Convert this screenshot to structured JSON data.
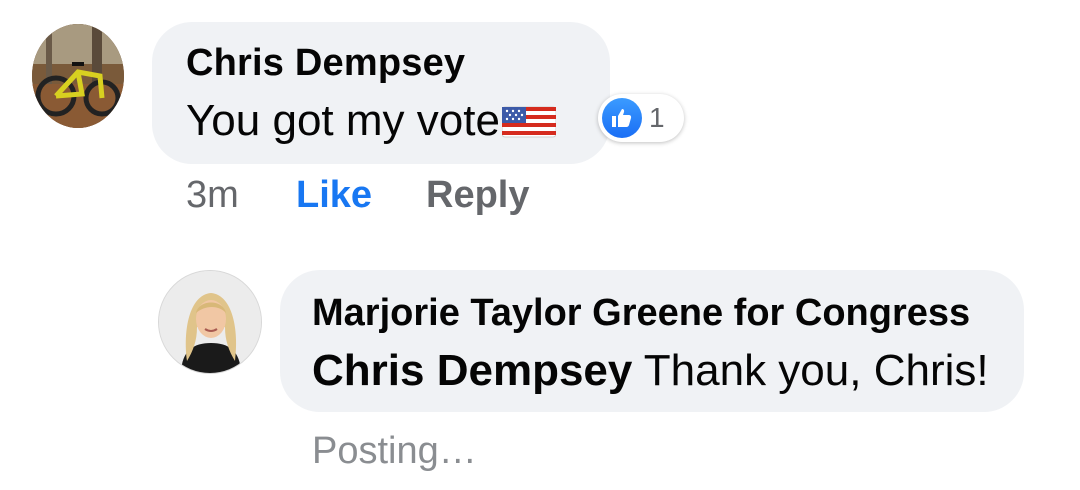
{
  "comments": [
    {
      "author": "Chris Dempsey",
      "text": "You got my vote",
      "emoji": "us-flag-emoji",
      "reaction": {
        "icon": "thumbs-up-icon",
        "count": "1"
      },
      "time": "3m",
      "like_label": "Like",
      "reply_label": "Reply"
    }
  ],
  "reply": {
    "author": "Marjorie Taylor Greene for Congress",
    "mention": "Chris Dempsey",
    "text": " Thank you, Chris!",
    "status": "Posting…"
  },
  "colors": {
    "bubble": "#f0f2f5",
    "link_blue": "#1877f2",
    "secondary_text": "#65676b",
    "pending_text": "#8a8d91"
  }
}
